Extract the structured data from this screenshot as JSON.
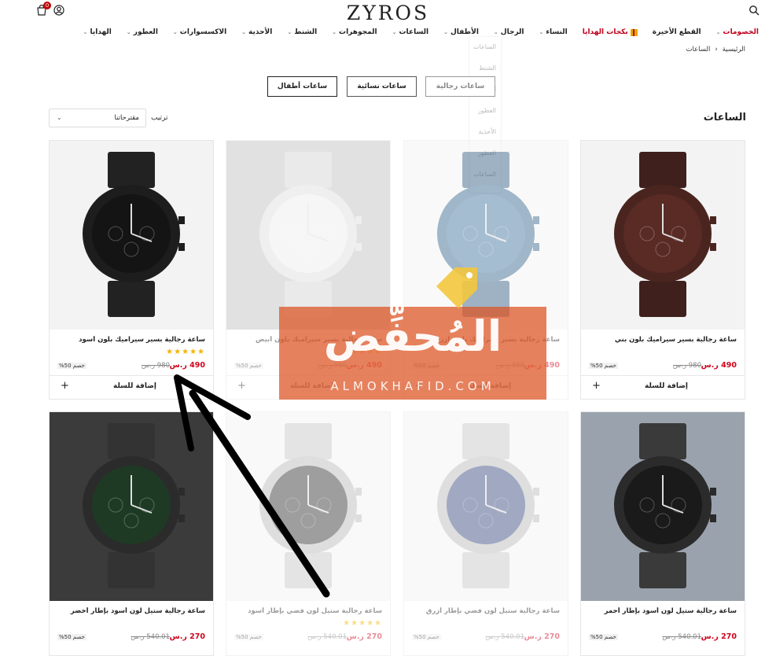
{
  "header": {
    "brand": "ZYROS",
    "cart_count": "0"
  },
  "nav": [
    {
      "label": "الخصومات",
      "chev": "⌄",
      "style": "sale"
    },
    {
      "label": "القطع الأخيرة",
      "chev": ""
    },
    {
      "label": "بكجات الهدايا",
      "chev": "",
      "style": "gifts"
    },
    {
      "label": "النساء",
      "chev": "⌄"
    },
    {
      "label": "الرجال",
      "chev": "⌄"
    },
    {
      "label": "الأطفال",
      "chev": "⌄"
    },
    {
      "label": "الساعات",
      "chev": "⌄"
    },
    {
      "label": "المجوهرات",
      "chev": "⌄"
    },
    {
      "label": "الشنط",
      "chev": "⌄"
    },
    {
      "label": "الأحذية",
      "chev": "⌄"
    },
    {
      "label": "الاكسسوارات",
      "chev": "⌄"
    },
    {
      "label": "العطور",
      "chev": "⌄"
    },
    {
      "label": "الهدايا",
      "chev": "⌄"
    }
  ],
  "breadcrumb": {
    "home": "الرئيسية",
    "sep": "‹",
    "current": "الساعات"
  },
  "ghost_menu": [
    "الساعات",
    "الشنط",
    "الاكسسوارات",
    "العطور",
    "الأحذية",
    "العطور",
    "الساعات"
  ],
  "categories": [
    "ساعات رجالية",
    "ساعات نسائية",
    "ساعات أطفال"
  ],
  "section": {
    "title": "الساعات",
    "sort_label": "ترتيب",
    "sort_value": "مقترحاتنا"
  },
  "products": [
    {
      "title": "ساعة رجالية بسير سيراميك بلون بني",
      "price": "490 ر.س",
      "old": "980 ر.س",
      "disc": "خصم 50%",
      "stars": "",
      "add": "إضافة للسلة",
      "case": "#4a2520",
      "dial": "#5a2a25",
      "strap": "#3f201c",
      "bg": "#f3f3f3"
    },
    {
      "title": "ساعة رجالية بسير سيراميك بلون أزرق",
      "price": "490 ر.س",
      "old": "980 ر.س",
      "disc": "خصم 50%",
      "stars": "",
      "add": "إضافة للسلة",
      "case": "#2e5f8a",
      "dial": "#3a6e9b",
      "strap": "#2b577e",
      "bg": "#f3f3f3"
    },
    {
      "title": "ساعة رجالية بسير سيراميك بلون أبيض",
      "price": "490 ر.س",
      "old": "980 ر.س",
      "disc": "خصم 50%",
      "stars": "★★★★★",
      "add": "إضافة للسلة",
      "case": "#dcdcdc",
      "dial": "#ececec",
      "strap": "#d2d2d2",
      "bg": "#bdbdbd"
    },
    {
      "title": "ساعة رجالية بسير سيراميك بلون أسود",
      "price": "490 ر.س",
      "old": "980 ر.س",
      "disc": "خصم 50%",
      "stars": "★★★★★",
      "add": "إضافة للسلة",
      "case": "#1d1d1d",
      "dial": "#141414",
      "strap": "#222222",
      "bg": "#f3f3f3"
    },
    {
      "title": "ساعة رجالية ستيل لون أسود بإطار أحمر",
      "price": "270 ر.س",
      "old": "540.01 ر.س",
      "disc": "خصم 50%",
      "stars": "",
      "add": "",
      "case": "#2b2b2b",
      "dial": "#1a1a1a",
      "strap": "#3a3a3a",
      "bg": "#9aa3ad"
    },
    {
      "title": "ساعة رجالية ستيل لون فضي بإطار أزرق",
      "price": "270 ر.س",
      "old": "540.01 ر.س",
      "disc": "خصم 50%",
      "stars": "",
      "add": "",
      "case": "#b8b8b8",
      "dial": "#2f3f7a",
      "strap": "#c4c4c4",
      "bg": "#f3f3f3"
    },
    {
      "title": "ساعة رجالية ستيل لون فضي بإطار أسود",
      "price": "270 ر.س",
      "old": "540.01 ر.س",
      "disc": "خصم 50%",
      "stars": "★★★★★",
      "add": "",
      "case": "#b8b8b8",
      "dial": "#2b2b2b",
      "strap": "#c4c4c4",
      "bg": "#f3f3f3"
    },
    {
      "title": "ساعة رجالية ستيل لون أسود بإطار أخضر",
      "price": "270 ر.س",
      "old": "540.01 ر.س",
      "disc": "خصم 50%",
      "stars": "",
      "add": "",
      "case": "#2b2b2b",
      "dial": "#1e3a25",
      "strap": "#333333",
      "bg": "#3b3b3b"
    }
  ],
  "watermark": {
    "main": "المُحفِّض",
    "sub": "ALMOKHAFID.COM"
  },
  "colors": {
    "accent": "#c0001a",
    "price": "#d0021b",
    "star": "#f5b400"
  }
}
